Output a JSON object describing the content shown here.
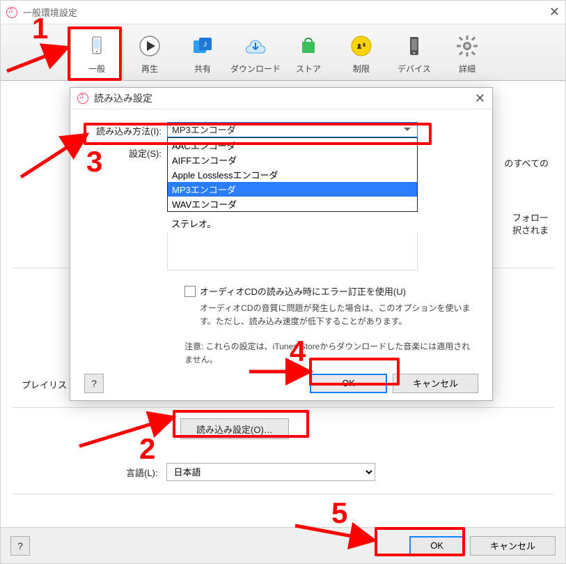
{
  "window": {
    "title": "一般環境設定",
    "close_glyph": "✕"
  },
  "toolbar": {
    "items": [
      {
        "label": "一般"
      },
      {
        "label": "再生"
      },
      {
        "label": "共有"
      },
      {
        "label": "ダウンロード"
      },
      {
        "label": "ストア"
      },
      {
        "label": "制限"
      },
      {
        "label": "デバイス"
      },
      {
        "label": "詳細"
      }
    ]
  },
  "main": {
    "playlist_label": "プレイリスト",
    "import_settings_button": "読み込み設定(O)…",
    "language_label": "言語(L):",
    "language_value": "日本語",
    "help_label": "?",
    "ok_label": "OK",
    "cancel_label": "キャンセル",
    "side_text1": "のすべての",
    "side_text2": "フォロー",
    "side_text3": "択されま"
  },
  "dialog": {
    "title": "読み込み設定",
    "close_glyph": "✕",
    "method_label": "読み込み方法(I):",
    "method_selected": "MP3エンコーダ",
    "method_options": [
      "AACエンコーダ",
      "AIFFエンコーダ",
      "Apple Losslessエンコーダ",
      "MP3エンコーダ",
      "WAVエンコーダ"
    ],
    "settings_label": "設定(S):",
    "stereo_note": "ステレオ。",
    "ec_label": "オーディオCDの読み込み時にエラー訂正を使用(U)",
    "ec_note": "オーディオCDの音質に問題が発生した場合は、このオプションを使います。ただし、読み込み速度が低下することがあります。",
    "store_note": "注意: これらの設定は、iTunes Storeからダウンロードした音楽には適用されません。",
    "help_label": "?",
    "ok_label": "OK",
    "cancel_label": "キャンセル"
  },
  "annotations": {
    "n1": "1",
    "n2": "2",
    "n3": "3",
    "n4": "4",
    "n5": "5"
  }
}
